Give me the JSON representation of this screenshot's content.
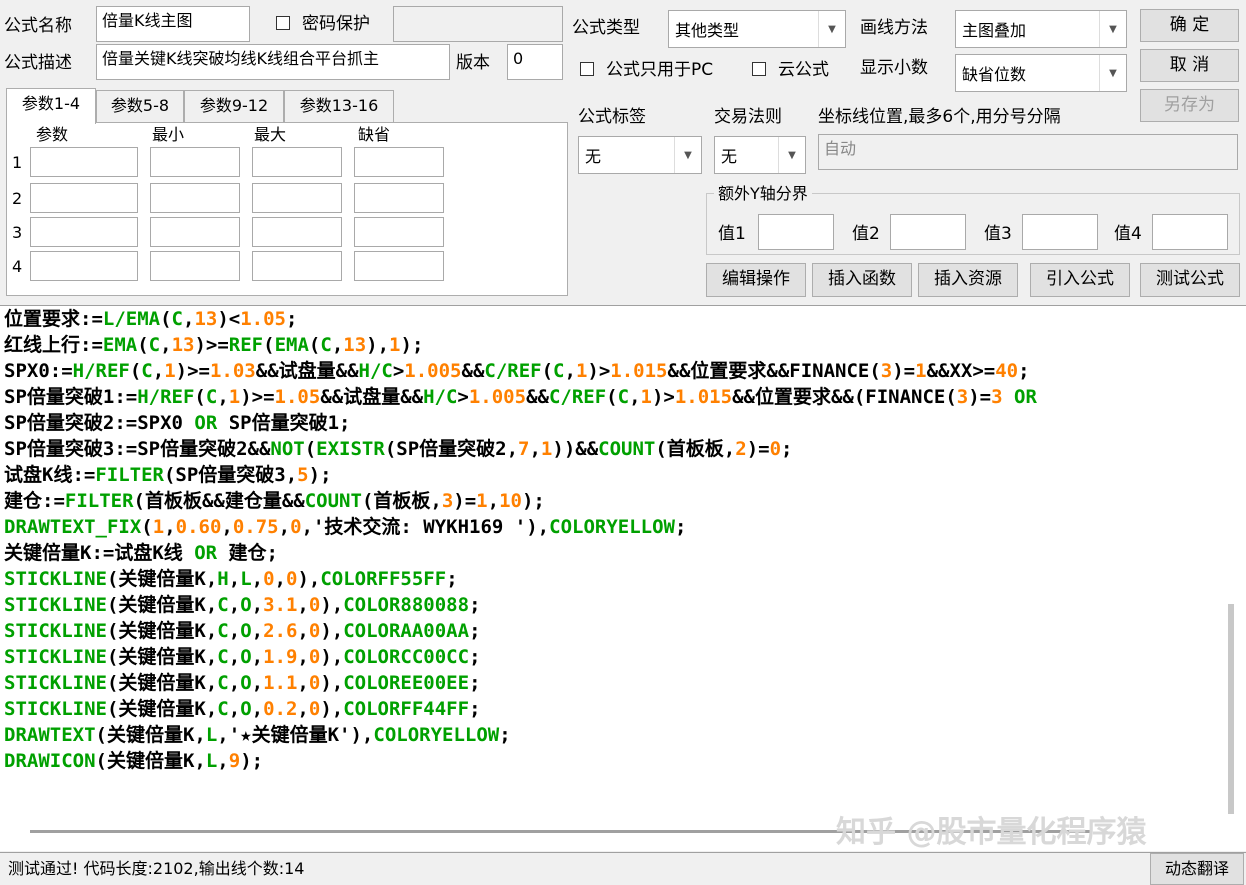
{
  "formula_name": {
    "label": "公式名称",
    "value": "倍量K线主图"
  },
  "password": {
    "label": "密码保护",
    "checked": false
  },
  "formula_desc": {
    "label": "公式描述",
    "value": "倍量关键K线突破均线K线组合平台抓主"
  },
  "version": {
    "label": "版本",
    "value": "0"
  },
  "formula_type": {
    "label": "公式类型",
    "value": "其他类型"
  },
  "draw_method": {
    "label": "画线方法",
    "value": "主图叠加"
  },
  "pc_only": {
    "label": "公式只用于PC",
    "checked": false
  },
  "cloud": {
    "label": "云公式",
    "checked": false
  },
  "decimal": {
    "label": "显示小数",
    "value": "缺省位数"
  },
  "buttons": {
    "ok": "确  定",
    "cancel": "取  消",
    "save_as": "另存为"
  },
  "tabs": [
    "参数1-4",
    "参数5-8",
    "参数9-12",
    "参数13-16"
  ],
  "param_headers": [
    "参数",
    "最小",
    "最大",
    "缺省"
  ],
  "param_rows": [
    "1",
    "2",
    "3",
    "4"
  ],
  "formula_tag": {
    "label": "公式标签",
    "value": "无"
  },
  "trade_rule": {
    "label": "交易法则",
    "value": "无"
  },
  "coord": {
    "label": "坐标线位置,最多6个,用分号分隔",
    "value": "自动"
  },
  "extra_y": {
    "label": "额外Y轴分界",
    "v1": "值1",
    "v2": "值2",
    "v3": "值3",
    "v4": "值4"
  },
  "actions": {
    "edit": "编辑操作",
    "insert_func": "插入函数",
    "insert_res": "插入资源",
    "import": "引入公式",
    "test": "测试公式"
  },
  "code_lines": [
    [
      [
        "k",
        "位置要求:="
      ],
      [
        "g",
        "L/EMA"
      ],
      [
        "k",
        "("
      ],
      [
        "g",
        "C"
      ],
      [
        "k",
        ","
      ],
      [
        "o",
        "13"
      ],
      [
        "k",
        ")<"
      ],
      [
        "o",
        "1.05"
      ],
      [
        "k",
        ";"
      ]
    ],
    [
      [
        "k",
        "红线上行:="
      ],
      [
        "g",
        "EMA"
      ],
      [
        "k",
        "("
      ],
      [
        "g",
        "C"
      ],
      [
        "k",
        ","
      ],
      [
        "o",
        "13"
      ],
      [
        "k",
        ")>="
      ],
      [
        "g",
        "REF"
      ],
      [
        "k",
        "("
      ],
      [
        "g",
        "EMA"
      ],
      [
        "k",
        "("
      ],
      [
        "g",
        "C"
      ],
      [
        "k",
        ","
      ],
      [
        "o",
        "13"
      ],
      [
        "k",
        "),"
      ],
      [
        "o",
        "1"
      ],
      [
        "k",
        ");"
      ]
    ],
    [
      [
        "k",
        "SPX0:="
      ],
      [
        "g",
        "H/REF"
      ],
      [
        "k",
        "("
      ],
      [
        "g",
        "C"
      ],
      [
        "k",
        ","
      ],
      [
        "o",
        "1"
      ],
      [
        "k",
        ")>="
      ],
      [
        "o",
        "1.03"
      ],
      [
        "k",
        "&&试盘量&&"
      ],
      [
        "g",
        "H/C"
      ],
      [
        "k",
        ">"
      ],
      [
        "o",
        "1.005"
      ],
      [
        "k",
        "&&"
      ],
      [
        "g",
        "C/REF"
      ],
      [
        "k",
        "("
      ],
      [
        "g",
        "C"
      ],
      [
        "k",
        ","
      ],
      [
        "o",
        "1"
      ],
      [
        "k",
        ")>"
      ],
      [
        "o",
        "1.015"
      ],
      [
        "k",
        "&&位置要求&&FINANCE("
      ],
      [
        "o",
        "3"
      ],
      [
        "k",
        ")="
      ],
      [
        "o",
        "1"
      ],
      [
        "k",
        "&&XX>="
      ],
      [
        "o",
        "40"
      ],
      [
        "k",
        ";"
      ]
    ],
    [
      [
        "k",
        "SP倍量突破1:="
      ],
      [
        "g",
        "H/REF"
      ],
      [
        "k",
        "("
      ],
      [
        "g",
        "C"
      ],
      [
        "k",
        ","
      ],
      [
        "o",
        "1"
      ],
      [
        "k",
        ")>="
      ],
      [
        "o",
        "1.05"
      ],
      [
        "k",
        "&&试盘量&&"
      ],
      [
        "g",
        "H/C"
      ],
      [
        "k",
        ">"
      ],
      [
        "o",
        "1.005"
      ],
      [
        "k",
        "&&"
      ],
      [
        "g",
        "C/REF"
      ],
      [
        "k",
        "("
      ],
      [
        "g",
        "C"
      ],
      [
        "k",
        ","
      ],
      [
        "o",
        "1"
      ],
      [
        "k",
        ")>"
      ],
      [
        "o",
        "1.015"
      ],
      [
        "k",
        "&&位置要求&&(FINANCE("
      ],
      [
        "o",
        "3"
      ],
      [
        "k",
        ")="
      ],
      [
        "o",
        "3"
      ],
      [
        "g",
        " OR"
      ]
    ],
    [
      [
        "k",
        "SP倍量突破2:=SPX0"
      ],
      [
        "g",
        " OR "
      ],
      [
        "k",
        "SP倍量突破1;"
      ]
    ],
    [
      [
        "k",
        "SP倍量突破3:=SP倍量突破2&&"
      ],
      [
        "g",
        "NOT"
      ],
      [
        "k",
        "("
      ],
      [
        "g",
        "EXISTR"
      ],
      [
        "k",
        "(SP倍量突破2,"
      ],
      [
        "o",
        "7"
      ],
      [
        "k",
        ","
      ],
      [
        "o",
        "1"
      ],
      [
        "k",
        "))&&"
      ],
      [
        "g",
        "COUNT"
      ],
      [
        "k",
        "(首板板,"
      ],
      [
        "o",
        "2"
      ],
      [
        "k",
        ")="
      ],
      [
        "o",
        "0"
      ],
      [
        "k",
        ";"
      ]
    ],
    [
      [
        "k",
        "试盘K线:="
      ],
      [
        "g",
        "FILTER"
      ],
      [
        "k",
        "(SP倍量突破3,"
      ],
      [
        "o",
        "5"
      ],
      [
        "k",
        ");"
      ]
    ],
    [
      [
        "k",
        "建仓:="
      ],
      [
        "g",
        "FILTER"
      ],
      [
        "k",
        "(首板板&&建仓量&&"
      ],
      [
        "g",
        "COUNT"
      ],
      [
        "k",
        "(首板板,"
      ],
      [
        "o",
        "3"
      ],
      [
        "k",
        ")="
      ],
      [
        "o",
        "1"
      ],
      [
        "k",
        ","
      ],
      [
        "o",
        "10"
      ],
      [
        "k",
        ");"
      ]
    ],
    [
      [
        "g",
        "DRAWTEXT_FIX"
      ],
      [
        "k",
        "("
      ],
      [
        "o",
        "1"
      ],
      [
        "k",
        ","
      ],
      [
        "o",
        "0.60"
      ],
      [
        "k",
        ","
      ],
      [
        "o",
        "0.75"
      ],
      [
        "k",
        ","
      ],
      [
        "o",
        "0"
      ],
      [
        "k",
        ",'技术交流: WYKH169 '),"
      ],
      [
        "g",
        "COLORYELLOW"
      ],
      [
        "k",
        ";"
      ]
    ],
    [
      [
        "k",
        "关键倍量K:=试盘K线"
      ],
      [
        "g",
        " OR "
      ],
      [
        "k",
        "建仓;"
      ]
    ],
    [
      [
        "g",
        "STICKLINE"
      ],
      [
        "k",
        "(关键倍量K,"
      ],
      [
        "g",
        "H"
      ],
      [
        "k",
        ","
      ],
      [
        "g",
        "L"
      ],
      [
        "k",
        ","
      ],
      [
        "o",
        "0"
      ],
      [
        "k",
        ","
      ],
      [
        "o",
        "0"
      ],
      [
        "k",
        "),"
      ],
      [
        "g",
        "COLORFF55FF"
      ],
      [
        "k",
        ";"
      ]
    ],
    [
      [
        "g",
        "STICKLINE"
      ],
      [
        "k",
        "(关键倍量K,"
      ],
      [
        "g",
        "C"
      ],
      [
        "k",
        ","
      ],
      [
        "g",
        "O"
      ],
      [
        "k",
        ","
      ],
      [
        "o",
        "3.1"
      ],
      [
        "k",
        ","
      ],
      [
        "o",
        "0"
      ],
      [
        "k",
        "),"
      ],
      [
        "g",
        "COLOR880088"
      ],
      [
        "k",
        ";"
      ]
    ],
    [
      [
        "g",
        "STICKLINE"
      ],
      [
        "k",
        "(关键倍量K,"
      ],
      [
        "g",
        "C"
      ],
      [
        "k",
        ","
      ],
      [
        "g",
        "O"
      ],
      [
        "k",
        ","
      ],
      [
        "o",
        "2.6"
      ],
      [
        "k",
        ","
      ],
      [
        "o",
        "0"
      ],
      [
        "k",
        "),"
      ],
      [
        "g",
        "COLORAA00AA"
      ],
      [
        "k",
        ";"
      ]
    ],
    [
      [
        "g",
        "STICKLINE"
      ],
      [
        "k",
        "(关键倍量K,"
      ],
      [
        "g",
        "C"
      ],
      [
        "k",
        ","
      ],
      [
        "g",
        "O"
      ],
      [
        "k",
        ","
      ],
      [
        "o",
        "1.9"
      ],
      [
        "k",
        ","
      ],
      [
        "o",
        "0"
      ],
      [
        "k",
        "),"
      ],
      [
        "g",
        "COLORCC00CC"
      ],
      [
        "k",
        ";"
      ]
    ],
    [
      [
        "g",
        "STICKLINE"
      ],
      [
        "k",
        "(关键倍量K,"
      ],
      [
        "g",
        "C"
      ],
      [
        "k",
        ","
      ],
      [
        "g",
        "O"
      ],
      [
        "k",
        ","
      ],
      [
        "o",
        "1.1"
      ],
      [
        "k",
        ","
      ],
      [
        "o",
        "0"
      ],
      [
        "k",
        "),"
      ],
      [
        "g",
        "COLOREE00EE"
      ],
      [
        "k",
        ";"
      ]
    ],
    [
      [
        "g",
        "STICKLINE"
      ],
      [
        "k",
        "(关键倍量K,"
      ],
      [
        "g",
        "C"
      ],
      [
        "k",
        ","
      ],
      [
        "g",
        "O"
      ],
      [
        "k",
        ","
      ],
      [
        "o",
        "0.2"
      ],
      [
        "k",
        ","
      ],
      [
        "o",
        "0"
      ],
      [
        "k",
        "),"
      ],
      [
        "g",
        "COLORFF44FF"
      ],
      [
        "k",
        ";"
      ]
    ],
    [
      [
        "g",
        "DRAWTEXT"
      ],
      [
        "k",
        "(关键倍量K,"
      ],
      [
        "g",
        "L"
      ],
      [
        "k",
        ",'★关键倍量K'),"
      ],
      [
        "g",
        "COLORYELLOW"
      ],
      [
        "k",
        ";"
      ]
    ],
    [
      [
        "g",
        "DRAWICON"
      ],
      [
        "k",
        "(关键倍量K,"
      ],
      [
        "g",
        "L"
      ],
      [
        "k",
        ","
      ],
      [
        "o",
        "9"
      ],
      [
        "k",
        ");"
      ]
    ]
  ],
  "watermark": "知乎 @股市量化程序猿",
  "status": "测试通过! 代码长度:2102,输出线个数:14",
  "translate_button": "动态翻译"
}
